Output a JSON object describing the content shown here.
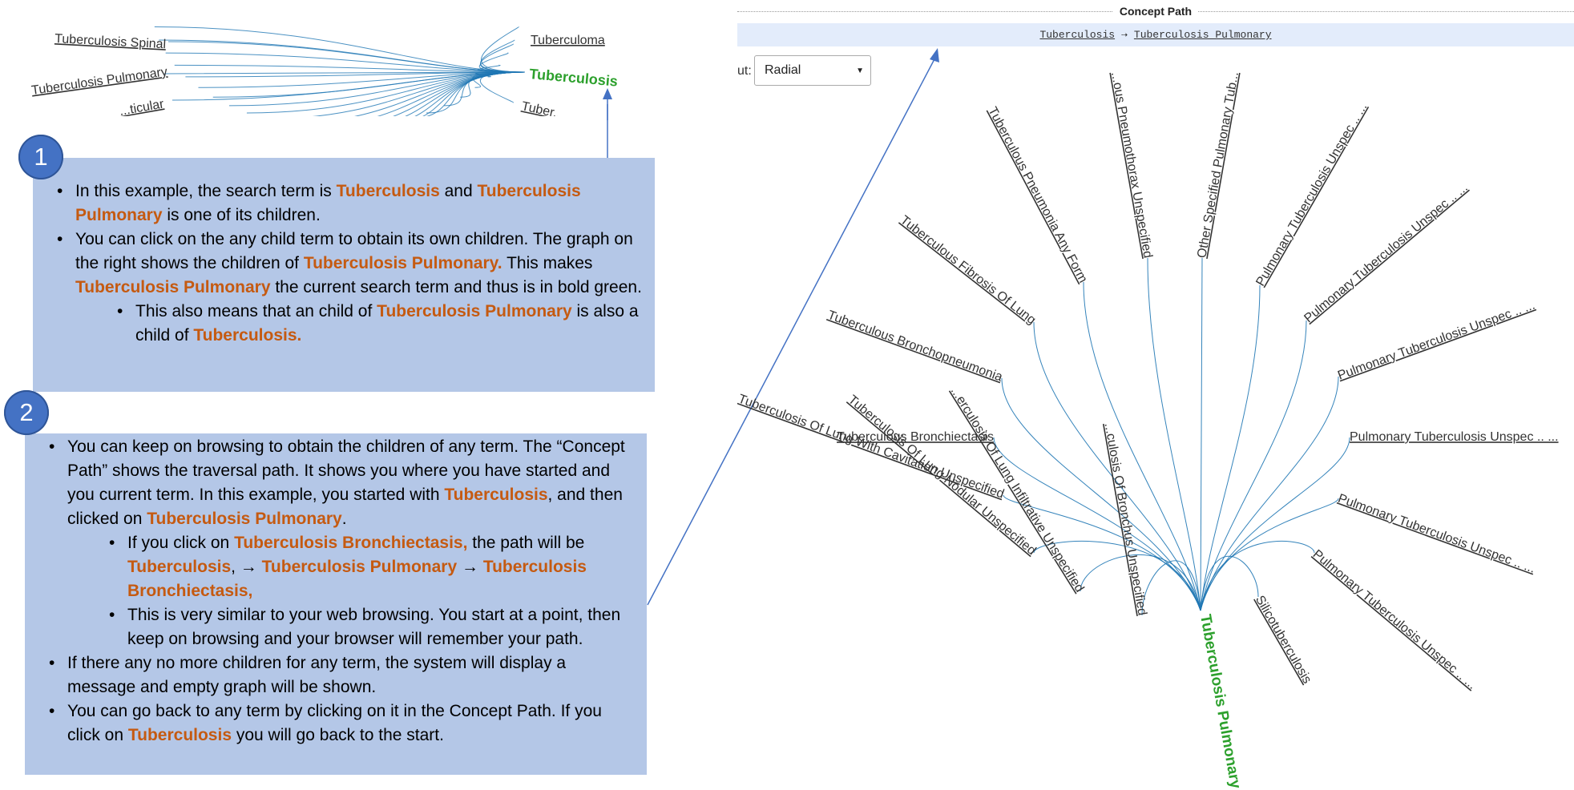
{
  "top_graph": {
    "labels_left": [
      "Tuberculosis Spinal",
      "Tuberculosis Pulmonary",
      "...ticular"
    ],
    "labels_right": [
      "Tuberculoma",
      "Tuberculosis",
      "Tuber..."
    ],
    "center_term": "Tuberculosis",
    "colors": {
      "center": "#2ca02c",
      "link": "#1f77b4",
      "arrow": "#4472c4"
    }
  },
  "panel1": {
    "badge": "1",
    "bullets": [
      {
        "parts": [
          "In this example, the search term is ",
          "Tuberculosis",
          " and ",
          "Tuberculosis Pulmonary",
          " is one of its children."
        ]
      },
      {
        "parts": [
          "You can click on the any child term to obtain its own children. The graph on the right shows the children of ",
          "Tuberculosis Pulmonary.",
          " This makes ",
          "Tuberculosis Pulmonary",
          " the current search term and thus is in bold green."
        ]
      },
      {
        "parts": [
          "This also means that an child of ",
          "Tuberculosis Pulmonary",
          " is also a child of ",
          "Tuberculosis."
        ]
      }
    ]
  },
  "panel2": {
    "badge": "2",
    "bullets": [
      {
        "parts": [
          "You can keep on browsing to obtain the children of any term. The “Concept Path” shows the traversal path. It shows you where you have started and you current term. In this example, you started with ",
          "Tuberculosis",
          ", and then clicked on ",
          "Tuberculosis Pulmonary",
          "."
        ]
      },
      {
        "parts": [
          "If you click on ",
          "Tuberculosis Bronchiectasis,",
          " the path will be ",
          "Tuberculosis",
          ",  → ",
          "Tuberculosis Pulmonary",
          " → ",
          "Tuberculosis Bronchiectasis,"
        ]
      },
      {
        "parts": [
          "This is very similar to your web browsing. You start at a point, then keep on browsing and your browser will remember your path."
        ]
      },
      {
        "parts": [
          "If there any no more children for any term, the system will display a message and empty graph will be shown."
        ]
      },
      {
        "parts": [
          "You can go back to any term by clicking on it in the Concept Path. If you click on ",
          "Tuberculosis",
          " you will go back to the start."
        ]
      }
    ]
  },
  "concept_path": {
    "title": "Concept Path",
    "crumbs": [
      "Tuberculosis",
      "Tuberculosis Pulmonary"
    ],
    "separator": "⇢"
  },
  "layout_control": {
    "label": "ut:",
    "selected": "Radial"
  },
  "radial_graph": {
    "root": "Tuberculosis Pulmonary",
    "root_color": "#2ca02c",
    "link_color": "#1f77b4",
    "children": [
      "Tuberculous Pneumonia Any Form",
      "...ous Pneumothorax Unspecified",
      "Other Specified Pulmonary Tub...",
      "Pulmonary Tuberculosis Unspec .. ...",
      "Pulmonary Tuberculosis Unspec .. ...",
      "Pulmonary Tuberculosis Unspec .. ...",
      "Tuberculous Fibrosis Of Lung",
      "Tuberculous Bronchopneumonia",
      "Tuberculous Bronchiectasis",
      "Pulmonary Tuberculosis Unspec .. ...",
      "Tuberculosis Of Lung With Cavitation Unspecified",
      "Pulmonary Tuberculosis Unspec .. ...",
      "Pulmonary Tuberculosis Unspec .. ...",
      "Tuberculosis Of Lung Nodular Unspecified",
      "...erculosis Of Lung Infiltrative Unspecified",
      "...culosis Of Bronchus Unspecified",
      "Silicotuberculosis"
    ]
  }
}
